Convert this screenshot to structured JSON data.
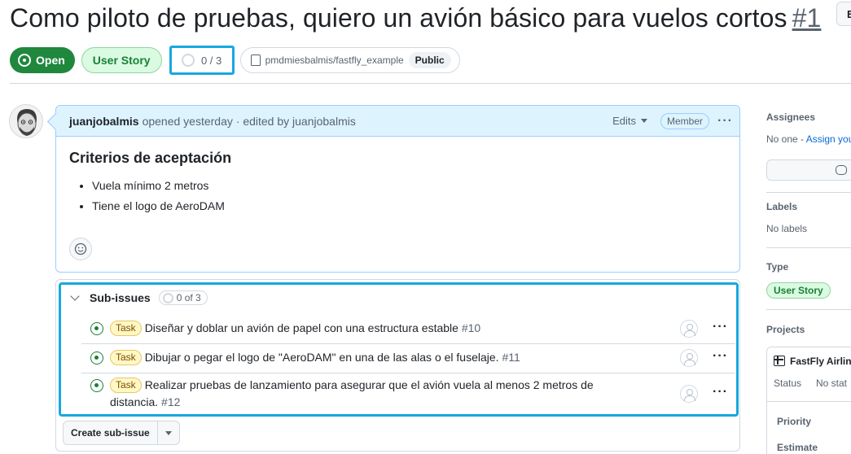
{
  "issue": {
    "title": "Como piloto de pruebas, quiero un avión básico para vuelos cortos",
    "number": "#1",
    "edit_button": "E",
    "state": "Open",
    "type": "User Story",
    "progress": "0 / 3",
    "repo": "pmdmiesbalmis/fastfly_example",
    "visibility": "Public"
  },
  "comment": {
    "author": "juanjobalmis",
    "meta": "opened yesterday · edited by juanjobalmis",
    "edits_label": "Edits",
    "role_badge": "Member",
    "heading": "Criterios de aceptación",
    "bullets": [
      "Vuela mínimo 2 metros",
      "Tiene el logo de AeroDAM"
    ]
  },
  "sub_issues": {
    "title": "Sub-issues",
    "counter": "0 of 3",
    "items": [
      {
        "tag": "Task",
        "text": "Diseñar y doblar un avión de papel con una estructura estable",
        "number": "#10"
      },
      {
        "tag": "Task",
        "text": "Dibujar o pegar el logo de \"AeroDAM\" en una de las alas o el fuselaje.",
        "number": "#11"
      },
      {
        "tag": "Task",
        "text": "Realizar pruebas de lanzamiento para asegurar que el avión vuela al menos 2 metros de distancia.",
        "number": "#12"
      }
    ],
    "create_button": "Create sub-issue"
  },
  "sidebar": {
    "assignees_label": "Assignees",
    "assignees_none": "No one - ",
    "assign_link": "Assign you",
    "labels_label": "Labels",
    "labels_value": "No labels",
    "type_label": "Type",
    "type_value": "User Story",
    "projects_label": "Projects",
    "project_name": "FastFly Airline",
    "status_key": "Status",
    "status_value": "No stat",
    "priority_key": "Priority",
    "estimate_key": "Estimate"
  },
  "colors": {
    "open_green": "#1f883d",
    "highlight_blue": "#17a8e0",
    "task_yellow": "#fff8c5"
  }
}
